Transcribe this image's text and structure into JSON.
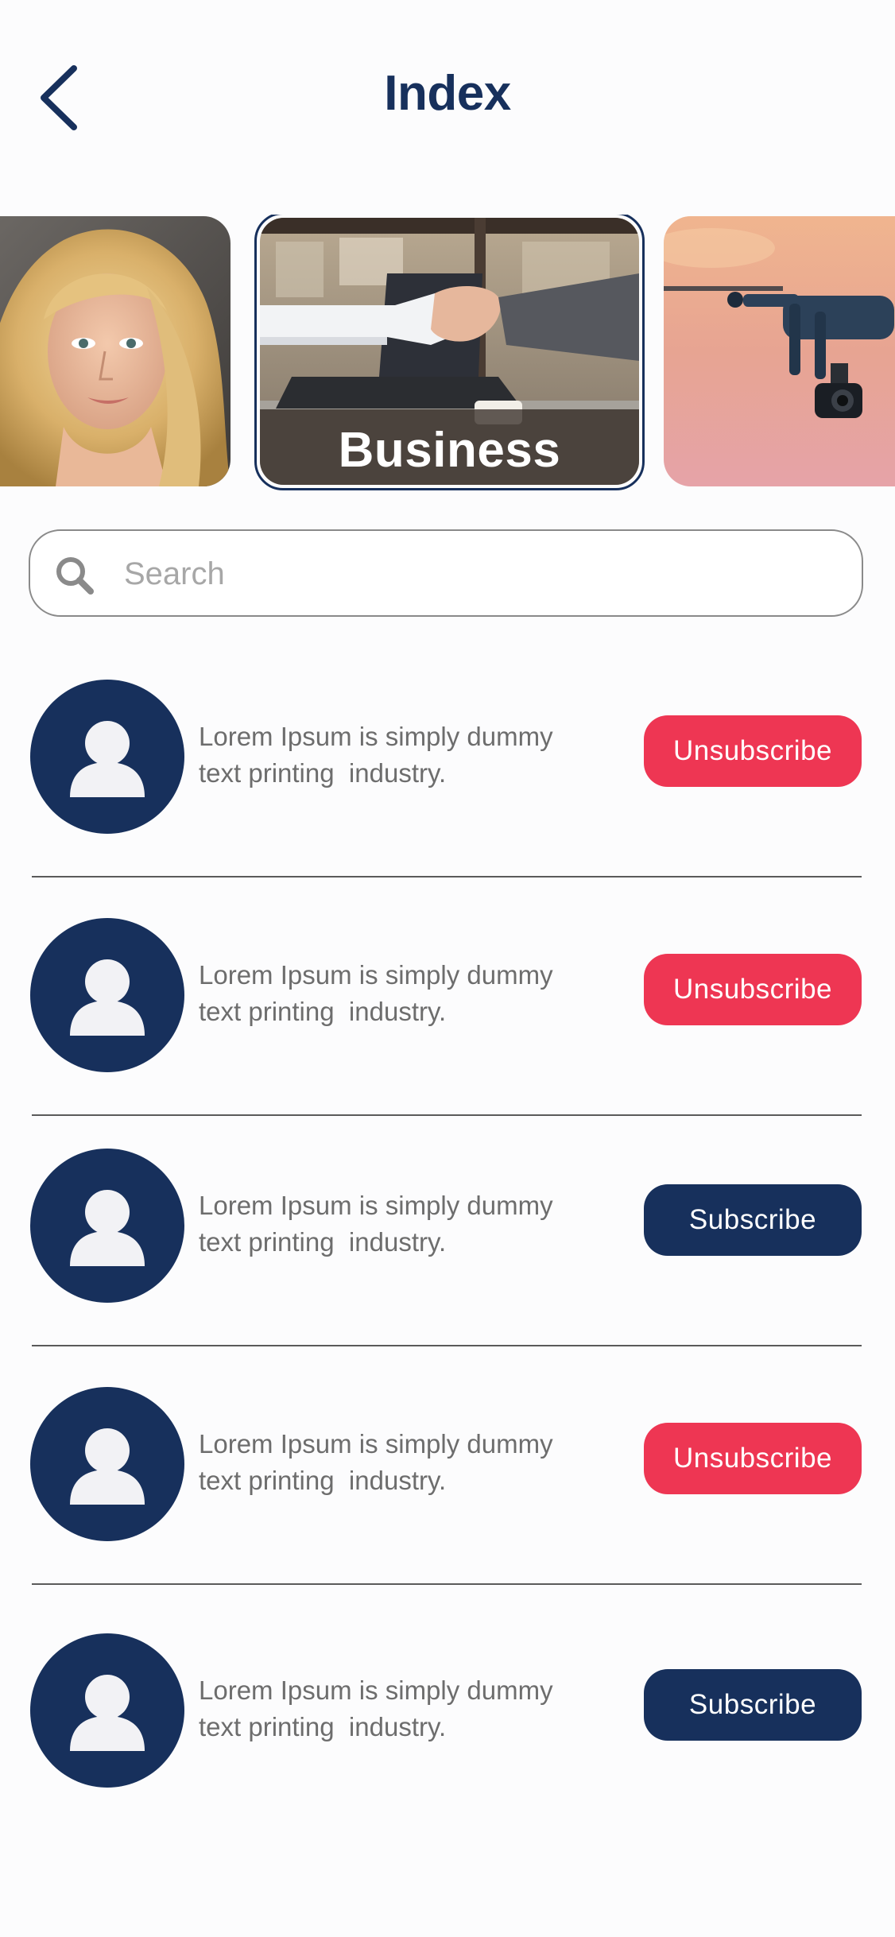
{
  "header": {
    "title": "Index",
    "back_icon": "chevron-left-icon"
  },
  "carousel": {
    "items": [
      {
        "label": "",
        "image": "portrait-woman-photo"
      },
      {
        "label": "Business",
        "image": "handshake-photo"
      },
      {
        "label": "",
        "image": "drone-photo"
      }
    ]
  },
  "search": {
    "placeholder": "Search",
    "value": "",
    "icon": "search-icon"
  },
  "list": {
    "items": [
      {
        "line1": "Lorem Ipsum is simply dummy",
        "line2": "text printing  industry.",
        "button": "Unsubscribe",
        "state": "subscribed"
      },
      {
        "line1": "Lorem Ipsum is simply dummy",
        "line2": "text printing  industry.",
        "button": "Unsubscribe",
        "state": "subscribed"
      },
      {
        "line1": "Lorem Ipsum is simply dummy",
        "line2": "text printing  industry.",
        "button": "Subscribe",
        "state": "unsubscribed"
      },
      {
        "line1": "Lorem Ipsum is simply dummy",
        "line2": "text printing  industry.",
        "button": "Unsubscribe",
        "state": "subscribed"
      },
      {
        "line1": "Lorem Ipsum is simply dummy",
        "line2": "text printing  industry.",
        "button": "Subscribe",
        "state": "unsubscribed"
      }
    ]
  },
  "colors": {
    "primary": "#17305c",
    "unsubscribe": "#ee3653",
    "background": "#fcfcfd",
    "text_muted": "#6d6d6d"
  }
}
